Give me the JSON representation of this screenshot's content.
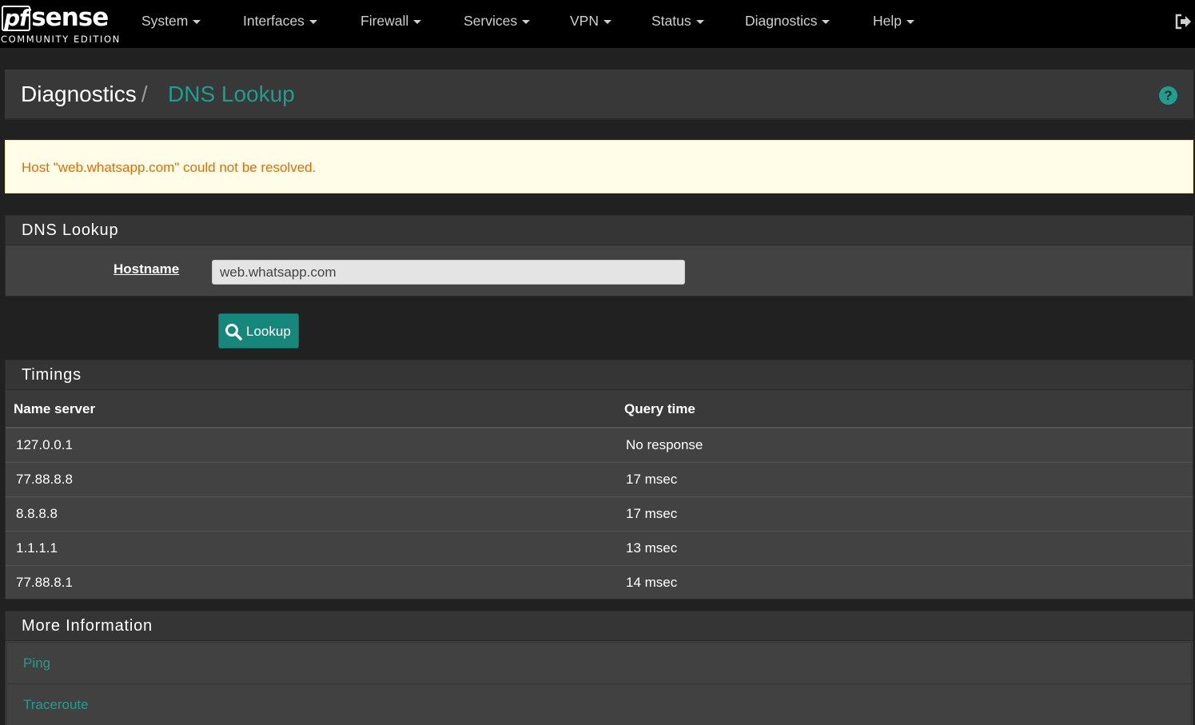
{
  "brand": {
    "logo": "sense",
    "logo_prefix": "pf",
    "subtitle": "COMMUNITY EDITION"
  },
  "nav": {
    "items": [
      {
        "label": "System"
      },
      {
        "label": "Interfaces"
      },
      {
        "label": "Firewall"
      },
      {
        "label": "Services"
      },
      {
        "label": "VPN"
      },
      {
        "label": "Status"
      },
      {
        "label": "Diagnostics"
      },
      {
        "label": "Help"
      }
    ],
    "logout_icon": "sign-out-icon"
  },
  "header": {
    "crumb_parent": "Diagnostics",
    "crumb_separator": "/",
    "crumb_current": "DNS Lookup",
    "help_icon": "question-circle-icon"
  },
  "alert": {
    "message": "Host \"web.whatsapp.com\" could not be resolved."
  },
  "lookup_panel": {
    "title": "DNS Lookup",
    "hostname_label": "Hostname",
    "hostname_value": "web.whatsapp.com",
    "button_label": "Lookup",
    "button_icon": "search-icon"
  },
  "timings": {
    "title": "Timings",
    "columns": [
      "Name server",
      "Query time"
    ],
    "rows": [
      {
        "server": "127.0.0.1",
        "time": "No response"
      },
      {
        "server": "77.88.8.8",
        "time": "17 msec"
      },
      {
        "server": "8.8.8.8",
        "time": "17 msec"
      },
      {
        "server": "1.1.1.1",
        "time": "13 msec"
      },
      {
        "server": "77.88.8.1",
        "time": "14 msec"
      }
    ]
  },
  "more_info": {
    "title": "More Information",
    "links": [
      "Ping",
      "Traceroute"
    ]
  },
  "colors": {
    "accent": "#1e9e8f",
    "button": "#15877b",
    "alert_bg": "#fffde7",
    "alert_text": "#e66b00",
    "navbar": "#000000"
  }
}
